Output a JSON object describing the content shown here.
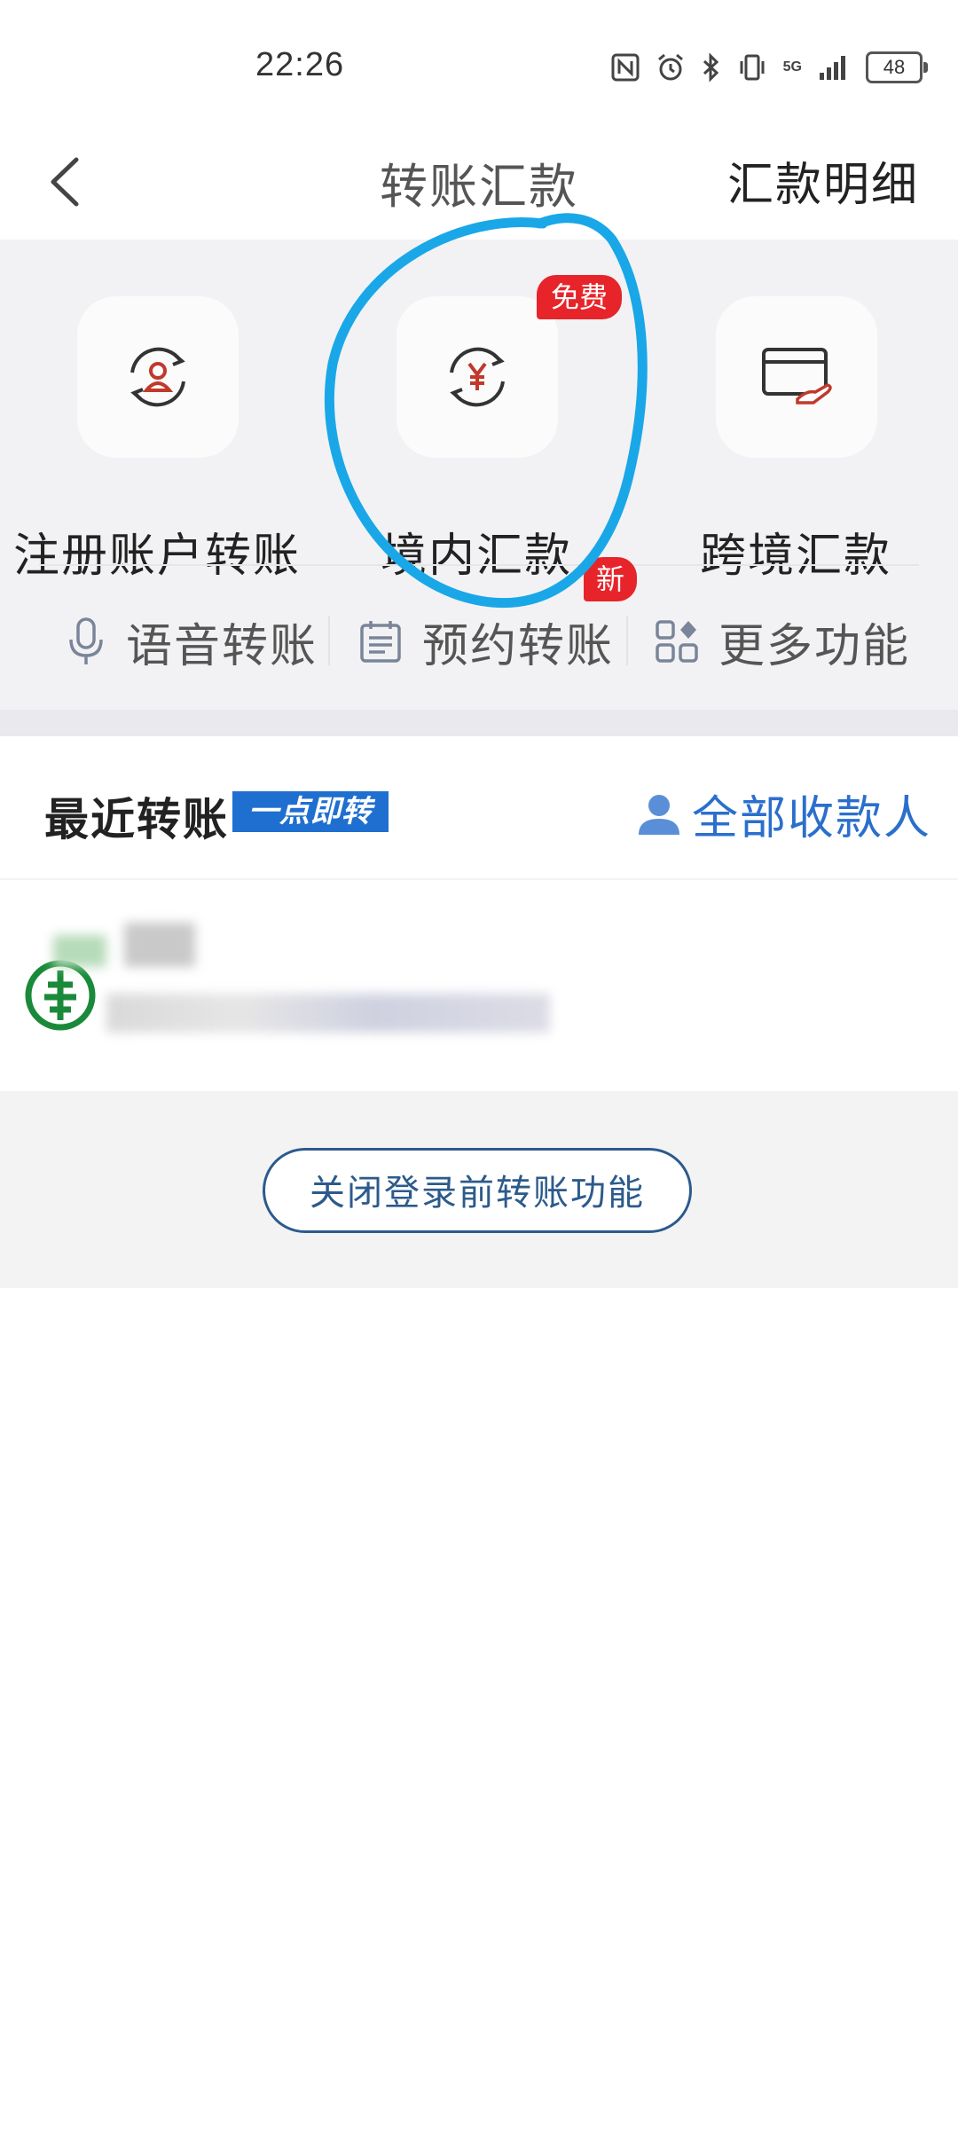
{
  "status_bar": {
    "time": "22:26",
    "battery": "48",
    "network": "5G",
    "icons": [
      "nfc-icon",
      "alarm-icon",
      "bluetooth-icon",
      "vibrate-icon",
      "signal-icon",
      "battery-icon"
    ]
  },
  "header": {
    "title": "转账汇款",
    "right_link": "汇款明细",
    "back_icon": "chevron-left-icon"
  },
  "functions": [
    {
      "label": "注册账户转账",
      "icon": "registered-account-transfer-icon"
    },
    {
      "label": "境内汇款",
      "icon": "domestic-remittance-yen-icon",
      "badge": "免费"
    },
    {
      "label": "跨境汇款",
      "icon": "cross-border-card-icon"
    }
  ],
  "quick_actions": [
    {
      "label": "语音转账",
      "icon": "microphone-icon"
    },
    {
      "label": "预约转账",
      "icon": "calendar-icon",
      "badge": "新"
    },
    {
      "label": "更多功能",
      "icon": "grid-more-icon"
    }
  ],
  "recent": {
    "title": "最近转账",
    "tag": "一点即转",
    "all_payees": "全部收款人"
  },
  "action": {
    "close_button": "关闭登录前转账功能"
  },
  "colors": {
    "accent": "#2b6fcc",
    "badge": "#e7242a",
    "annotation": "#1aa7e8",
    "bank_green": "#1a8a3a"
  }
}
